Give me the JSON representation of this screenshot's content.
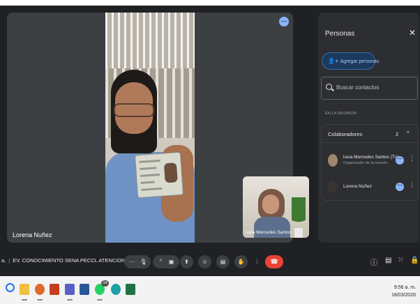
{
  "main_video": {
    "participant_name": "Lorena Nuñez"
  },
  "self_view": {
    "participant_name": "lucia Mercedes Santos"
  },
  "people_panel": {
    "title": "Personas",
    "close_symbol": "✕",
    "add_people_label": "Agregar personas",
    "search_placeholder": "Buscar contactos",
    "section_label": "EN LA REUNIÓN",
    "group": {
      "title": "Colaboradores",
      "count": "2",
      "participants": [
        {
          "name": "lucia Mercedes Santos (Tú)",
          "role": "Organizador de la reunión"
        },
        {
          "name": "Lorena Nuñez",
          "role": ""
        }
      ]
    }
  },
  "controls": {
    "meeting_prefix": "a.",
    "meeting_title": "EV. CONOCIMIENTO SENA PECCL ATENCION..."
  },
  "taskbar": {
    "time": "9:56 a. m.",
    "date": "18/03/2026",
    "whatsapp_badge": "14"
  },
  "colors": {
    "meet_background": "#202124",
    "panel_background": "#2d2e31",
    "accent_blue": "#8ab4f8",
    "leave_red": "#ea4335"
  },
  "icons": [
    "more-options-icon",
    "close-icon",
    "add-person-icon",
    "search-icon",
    "chevron-up-icon",
    "microphone-icon",
    "camera-icon",
    "present-icon",
    "emoji-icon",
    "captions-icon",
    "raise-hand-icon",
    "leave-call-icon",
    "info-icon",
    "chat-icon",
    "activities-icon",
    "lock-icon"
  ]
}
